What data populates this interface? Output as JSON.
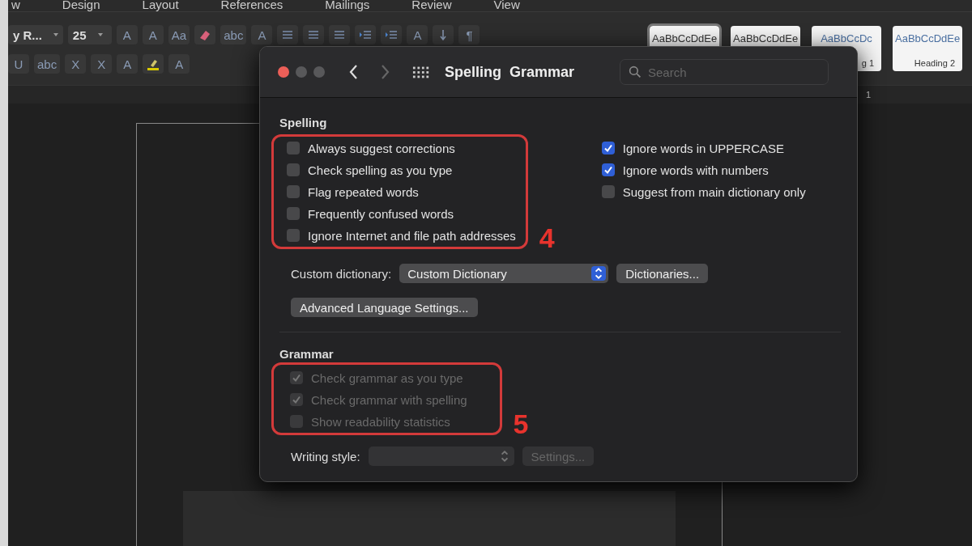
{
  "menu": [
    "w",
    "Design",
    "Layout",
    "References",
    "Mailings",
    "Review",
    "View"
  ],
  "toolbar": {
    "row1": [
      {
        "kind": "dropdown",
        "text": "y R..."
      },
      {
        "kind": "dropdown",
        "text": "25"
      },
      {
        "kind": "glyph",
        "text": "A"
      },
      {
        "kind": "glyph",
        "text": "A"
      },
      {
        "kind": "glyph",
        "text": "Aa"
      },
      {
        "kind": "eraser"
      },
      {
        "kind": "glyph",
        "text": "abc"
      },
      {
        "kind": "glyph",
        "text": "A"
      },
      {
        "kind": "list"
      },
      {
        "kind": "list"
      },
      {
        "kind": "list"
      },
      {
        "kind": "indent"
      },
      {
        "kind": "indent"
      },
      {
        "kind": "glyph",
        "text": "A"
      },
      {
        "kind": "sort"
      },
      {
        "kind": "glyph",
        "text": "¶"
      }
    ],
    "row2": [
      {
        "kind": "glyph",
        "text": "U"
      },
      {
        "kind": "glyph",
        "text": "abc"
      },
      {
        "kind": "glyph",
        "text": "X"
      },
      {
        "kind": "glyph",
        "text": "X"
      },
      {
        "kind": "glyph",
        "text": "A"
      },
      {
        "kind": "highlight"
      },
      {
        "kind": "glyph",
        "text": "A"
      }
    ]
  },
  "styles_gallery": [
    {
      "sample": "AaBbCcDdEe",
      "selected": true
    },
    {
      "sample": "AaBbCcDdEe",
      "selected": false
    },
    {
      "sample": "AaBbCcDc",
      "label": "g 1",
      "selected": false
    },
    {
      "sample": "AaBbCcDdEe",
      "label": "Heading 2",
      "selected": false
    }
  ],
  "ruler": "1",
  "dialog": {
    "title": "Spelling  Grammar",
    "search": {
      "placeholder": "Search"
    },
    "spelling": {
      "heading": "Spelling",
      "annotation": "4",
      "options_left": [
        {
          "label": "Always suggest corrections",
          "checked": false
        },
        {
          "label": "Check spelling as you type",
          "checked": false
        },
        {
          "label": "Flag repeated words",
          "checked": false
        },
        {
          "label": "Frequently confused words",
          "checked": false
        },
        {
          "label": "Ignore Internet and file path addresses",
          "checked": false
        }
      ],
      "options_right": [
        {
          "label": "Ignore words in UPPERCASE",
          "checked": true
        },
        {
          "label": "Ignore words with numbers",
          "checked": true
        },
        {
          "label": "Suggest from main dictionary only",
          "checked": false
        }
      ],
      "custom_dictionary": {
        "label": "Custom dictionary:",
        "value": "Custom Dictionary"
      },
      "dictionaries_button": "Dictionaries...",
      "advanced_button": "Advanced Language Settings..."
    },
    "grammar": {
      "heading": "Grammar",
      "annotation": "5",
      "options": [
        {
          "label": "Check grammar as you type",
          "checked": true,
          "disabled": true
        },
        {
          "label": "Check grammar with spelling",
          "checked": true,
          "disabled": true
        },
        {
          "label": "Show readability statistics",
          "checked": false,
          "disabled": true
        }
      ],
      "writing_style": {
        "label": "Writing style:",
        "disabled": true
      },
      "settings_button": {
        "label": "Settings...",
        "disabled": true
      }
    }
  }
}
